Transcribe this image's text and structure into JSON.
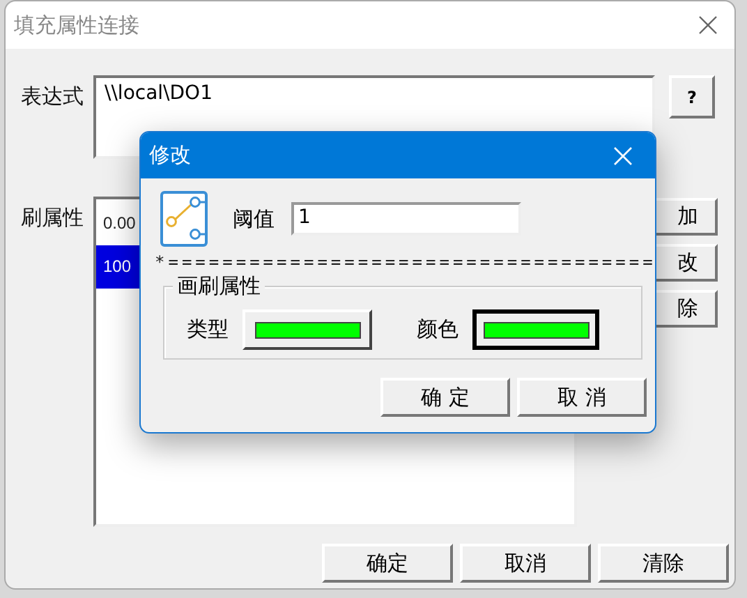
{
  "window": {
    "title": "填充属性连接"
  },
  "expression": {
    "label": "表达式",
    "value": "\\\\local\\DO1",
    "help_button": "?"
  },
  "brush_list": {
    "label": "刷属性",
    "rows": [
      {
        "text": "0.00",
        "selected": false
      },
      {
        "text": "100",
        "selected": true
      }
    ]
  },
  "side_buttons": [
    "加",
    "改",
    "除"
  ],
  "buttons": [
    "确定",
    "取消",
    "清除"
  ],
  "dialog": {
    "title": "修改",
    "threshold": {
      "label": "阈值",
      "value": "1"
    },
    "separator": "*====================================",
    "group": {
      "title": "画刷属性",
      "fields": [
        {
          "label": "类型",
          "color": "#00ff00",
          "focused": false
        },
        {
          "label": "颜色",
          "color": "#00ff00",
          "focused": true
        }
      ]
    },
    "buttons": [
      "确 定",
      "取 消"
    ]
  }
}
